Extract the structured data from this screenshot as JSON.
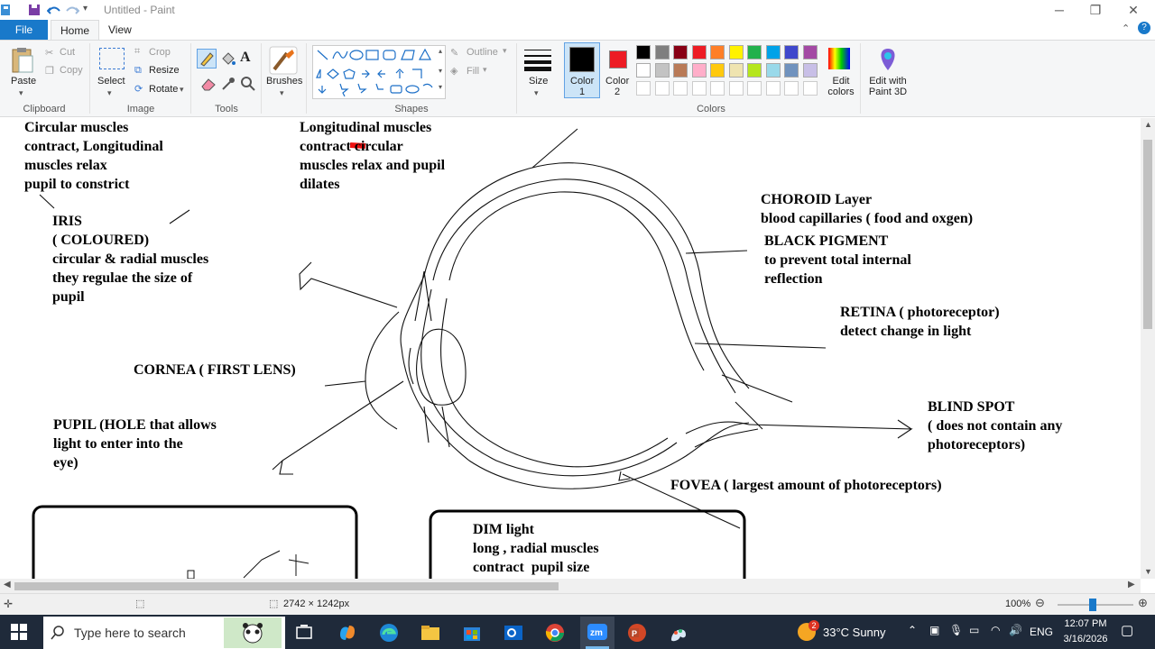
{
  "window": {
    "title": "Untitled - Paint"
  },
  "tabs": {
    "file": "File",
    "home": "Home",
    "view": "View"
  },
  "ribbon": {
    "clipboard": {
      "paste": "Paste",
      "cut": "Cut",
      "copy": "Copy",
      "label": "Clipboard"
    },
    "image": {
      "select": "Select",
      "crop": "Crop",
      "resize": "Resize",
      "rotate": "Rotate",
      "label": "Image"
    },
    "tools": {
      "label": "Tools"
    },
    "brushes": {
      "label": "Brushes"
    },
    "shapes": {
      "outline": "Outline",
      "fill": "Fill",
      "label": "Shapes"
    },
    "size": {
      "label": "Size"
    },
    "colors": {
      "color1": "Color",
      "color1_num": "1",
      "color2": "Color",
      "color2_num": "2",
      "edit_colors": "Edit colors",
      "label": "Colors",
      "palette_row1": [
        "#000000",
        "#7f7f7f",
        "#880015",
        "#ed1c24",
        "#ff7f27",
        "#fff200",
        "#22b14c",
        "#00a2e8",
        "#3f48cc",
        "#a349a4"
      ],
      "palette_row2": [
        "#ffffff",
        "#c3c3c3",
        "#b97a57",
        "#ffaec9",
        "#ffc90e",
        "#efe4b0",
        "#b5e61d",
        "#99d9ea",
        "#7092be",
        "#c8bfe7"
      ],
      "color1_value": "#000000",
      "color2_value": "#ed1c24"
    },
    "paint3d": "Edit with Paint 3D"
  },
  "canvas": {
    "notes": {
      "circular": "Circular muscles\ncontract, Longitudinal\nmuscles relax\npupil to constrict",
      "longitudinal": "Longitudinal muscles\ncontract circular\nmuscles relax and pupil\ndilates",
      "iris": "IRIS\n( COLOURED)\ncircular & radial muscles\nthey regulae the size of\npupil",
      "choroid": "CHOROID Layer\nblood capillaries ( food and oxgen)",
      "pigment": "BLACK PIGMENT\nto prevent total internal\nreflection",
      "retina": "RETINA ( photoreceptor)\ndetect change in light",
      "cornea": "CORNEA ( FIRST LENS)",
      "blindspot": "BLIND SPOT\n( does not contain any\nphotoreceptors)",
      "pupil": "PUPIL (HOLE that allows\nlight to enter into the\neye)",
      "fovea": "FOVEA ( largest amount of photoreceptors)",
      "dim": "DIM light\nlong , radial muscles\ncontract  pupil size"
    }
  },
  "status": {
    "dimensions": "2742 × 1242px",
    "zoom": "100%"
  },
  "taskbar": {
    "search_placeholder": "Type here to search",
    "weather": "33°C  Sunny",
    "weather_badge": "2",
    "lang": "ENG",
    "time": "12:07 PM",
    "date": "3/16/2026"
  }
}
